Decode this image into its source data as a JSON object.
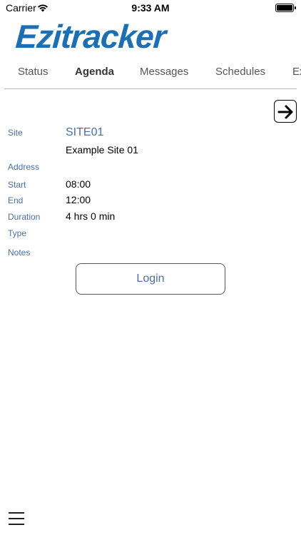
{
  "status_bar": {
    "carrier": "Carrier",
    "time": "9:33 AM"
  },
  "app": {
    "logo_text": "Ezitracker",
    "brand_color": "#1a6fb5",
    "label_color": "#4a6fa5"
  },
  "tabs": [
    {
      "label": "Status",
      "active": false
    },
    {
      "label": "Agenda",
      "active": true
    },
    {
      "label": "Messages",
      "active": false
    },
    {
      "label": "Schedules",
      "active": false
    },
    {
      "label": "Ex",
      "active": false
    }
  ],
  "agenda": {
    "site_label": "Site",
    "site_code": "SITE01",
    "site_name": "Example Site 01",
    "address_label": "Address",
    "start_label": "Start",
    "start_value": "08:00",
    "end_label": "End",
    "end_value": "12:00",
    "duration_label": "Duration",
    "duration_value": "4 hrs 0 min",
    "type_label": "Type",
    "notes_label": "Notes"
  },
  "actions": {
    "login_label": "Login",
    "next_icon": "arrow-right-icon",
    "menu_icon": "hamburger-menu-icon"
  }
}
